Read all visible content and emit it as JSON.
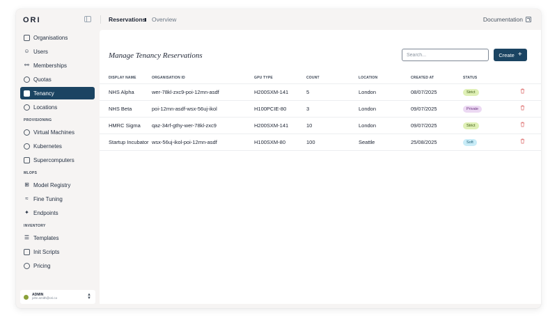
{
  "app": {
    "logo": "ORI"
  },
  "breadcrumb": {
    "current": "Reservations",
    "next": "Overview"
  },
  "header": {
    "documentation": "Documentation"
  },
  "sidebar": {
    "items_top": [
      {
        "label": "Organisations",
        "icon": "building-icon"
      },
      {
        "label": "Users",
        "icon": "users-icon"
      },
      {
        "label": "Memberships",
        "icon": "user-plus-icon"
      },
      {
        "label": "Quotas",
        "icon": "pie-icon"
      },
      {
        "label": "Tenancy",
        "icon": "lock-icon",
        "active": true
      },
      {
        "label": "Locations",
        "icon": "location-icon"
      }
    ],
    "section_provisioning": "PROVISIONING",
    "items_provisioning": [
      {
        "label": "Virtual Machines",
        "icon": "globe-icon"
      },
      {
        "label": "Kubernetes",
        "icon": "kubernetes-icon"
      },
      {
        "label": "Supercomputers",
        "icon": "server-icon"
      }
    ],
    "section_mlops": "MLOPS",
    "items_mlops": [
      {
        "label": "Model Registry",
        "icon": "grid-icon"
      },
      {
        "label": "Fine Tuning",
        "icon": "tuning-icon"
      },
      {
        "label": "Endpoints",
        "icon": "endpoint-icon"
      }
    ],
    "section_inventory": "INVENTORY",
    "items_inventory": [
      {
        "label": "Templates",
        "icon": "layers-icon"
      },
      {
        "label": "Init Scripts",
        "icon": "terminal-icon"
      },
      {
        "label": "Pricing",
        "icon": "dollar-icon"
      }
    ],
    "user": {
      "role": "ADMIN",
      "email": "john.smith@ori.co"
    }
  },
  "main": {
    "title": "Manage Tenancy Reservations",
    "search_placeholder": "Search...",
    "create_label": "Create",
    "columns": [
      "DISPLAY NAME",
      "ORGANISATION ID",
      "GPU TYPE",
      "COUNT",
      "LOCATION",
      "CREATED AT",
      "STATUS"
    ],
    "rows": [
      {
        "name": "NHS Alpha",
        "org_id": "wer-78kl-zxc9-poi-12mn-asdf",
        "gpu": "H200SXM-141",
        "count": "5",
        "location": "London",
        "created": "08/07/2025",
        "status": "Strict"
      },
      {
        "name": "NHS Beta",
        "org_id": "poi-12mn-asdf-wsx-56uj-ikol",
        "gpu": "H100PCIE-80",
        "count": "3",
        "location": "London",
        "created": "09/07/2025",
        "status": "Private"
      },
      {
        "name": "HMRC Sigma",
        "org_id": "qaz-34rf-gthy-wer-78kl-zxc9",
        "gpu": "H200SXM-141",
        "count": "10",
        "location": "London",
        "created": "09/07/2025",
        "status": "Strict"
      },
      {
        "name": "Startup Incubator",
        "org_id": "wsx-56uj-ikol-poi-12mn-asdf",
        "gpu": "H100SXM-80",
        "count": "100",
        "location": "Seattle",
        "created": "25/08/2025",
        "status": "Soft"
      }
    ]
  },
  "colors": {
    "accent": "#1b4462",
    "strict_bg": "#dff0b6",
    "private_bg": "#ecd9f3",
    "soft_bg": "#c9ecf7",
    "delete": "#e07a7a"
  }
}
